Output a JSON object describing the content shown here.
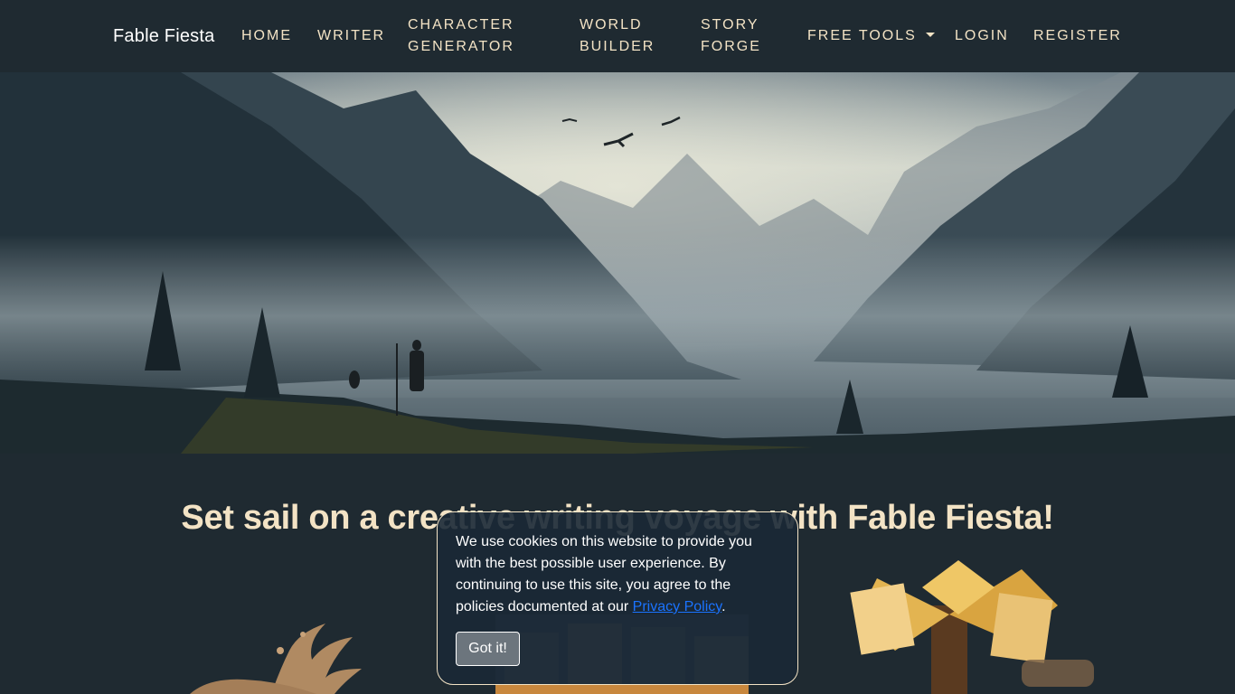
{
  "brand": "Fable Fiesta",
  "nav": {
    "home": "HOME",
    "writer": "WRITER",
    "character_line1": "CHARACTER",
    "character_line2": "GENERATOR",
    "world_line1": "WORLD",
    "world_line2": "BUILDER",
    "story_line1": "STORY",
    "story_line2": "FORGE",
    "free_tools": "FREE TOOLS",
    "login": "LOGIN",
    "register": "REGISTER"
  },
  "hero": {
    "icon": "misty-mountain-valley-image"
  },
  "headline": "Set sail on a creative writing voyage with Fable Fiesta!",
  "cookie": {
    "text_before_link": "We use cookies on this website to provide you with the best possible user experience. By continuing to use this site, you agree to the policies documented at our ",
    "link": "Privacy Policy",
    "text_after_link": ".",
    "button": "Got it!"
  },
  "colors": {
    "background": "#1f2a31",
    "accent_text": "#f3e3c5",
    "link": "#1a73ff",
    "button": "#6c757d"
  }
}
